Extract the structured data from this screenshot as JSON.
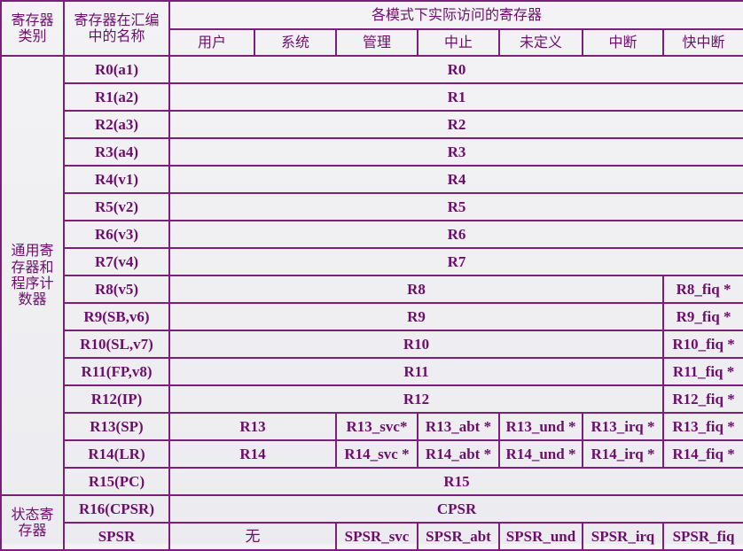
{
  "header": {
    "category": [
      "寄存器",
      "类别"
    ],
    "asm_name": [
      "寄存器在汇编",
      "中的名称"
    ],
    "modes_title": "各模式下实际访问的寄存器",
    "modes": [
      "用户",
      "系统",
      "管理",
      "中止",
      "未定义",
      "中断",
      "快中断"
    ]
  },
  "categories": {
    "general": [
      "通用寄",
      "存器和",
      "程序计",
      "数器"
    ],
    "status": [
      "状态寄",
      "存器"
    ]
  },
  "rows": [
    {
      "name": "R0(a1)",
      "shared": "R0"
    },
    {
      "name": "R1(a2)",
      "shared": "R1"
    },
    {
      "name": "R2(a3)",
      "shared": "R2"
    },
    {
      "name": "R3(a4)",
      "shared": "R3"
    },
    {
      "name": "R4(v1)",
      "shared": "R4"
    },
    {
      "name": "R5(v2)",
      "shared": "R5"
    },
    {
      "name": "R6(v3)",
      "shared": "R6"
    },
    {
      "name": "R7(v4)",
      "shared": "R7"
    },
    {
      "name": "R8(v5)",
      "shared": "R8",
      "fiq": "R8_fiq *"
    },
    {
      "name": "R9(SB,v6)",
      "shared": "R9",
      "fiq": "R9_fiq *"
    },
    {
      "name": "R10(SL,v7)",
      "shared": "R10",
      "fiq": "R10_fiq *"
    },
    {
      "name": "R11(FP,v8)",
      "shared": "R11",
      "fiq": "R11_fiq *"
    },
    {
      "name": "R12(IP)",
      "shared": "R12",
      "fiq": "R12_fiq *"
    },
    {
      "name": "R13(SP)",
      "usr_sys": "R13",
      "svc": "R13_svc*",
      "abt": "R13_abt *",
      "und": "R13_und *",
      "irq": "R13_irq *",
      "fiq": "R13_fiq *"
    },
    {
      "name": "R14(LR)",
      "usr_sys": "R14",
      "svc": "R14_svc *",
      "abt": "R14_abt *",
      "und": "R14_und *",
      "irq": "R14_irq *",
      "fiq": "R14_fiq *"
    },
    {
      "name": "R15(PC)",
      "shared": "R15"
    },
    {
      "name": "R16(CPSR)",
      "shared": "CPSR"
    },
    {
      "name": "SPSR",
      "usr_sys": "无",
      "svc": "SPSR_svc",
      "abt": "SPSR_abt",
      "und": "SPSR_und",
      "irq": "SPSR_irq",
      "fiq": "SPSR_fiq"
    }
  ]
}
